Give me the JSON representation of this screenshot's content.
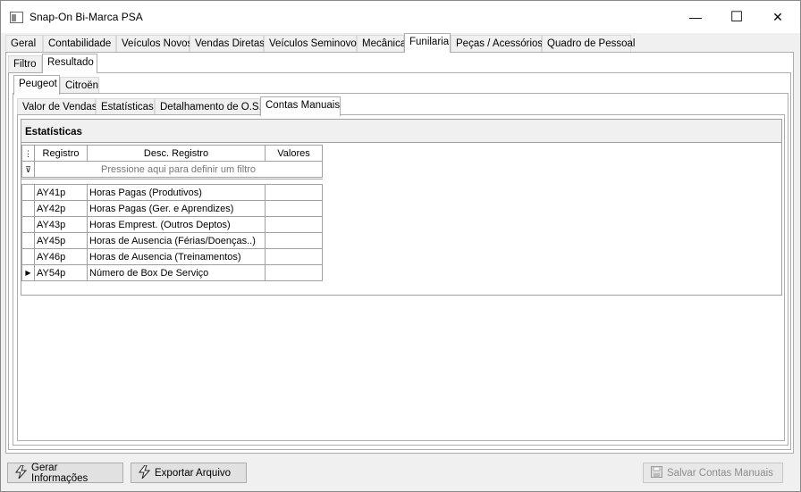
{
  "window": {
    "title": "Snap-On Bi-Marca PSA",
    "min_glyph": "—",
    "max_glyph": "☐",
    "close_glyph": "✕"
  },
  "main_tabs": [
    "Geral",
    "Contabilidade",
    "Veículos Novos",
    "Vendas Diretas",
    "Veículos Seminovos",
    "Mecânica",
    "Funilaria",
    "Peças / Acessórios",
    "Quadro de Pessoal"
  ],
  "main_tab_active": "Funilaria",
  "sub_tabs": [
    "Filtro",
    "Resultado"
  ],
  "sub_tab_active": "Resultado",
  "brand_tabs": [
    "Peugeot",
    "Citroën"
  ],
  "brand_tab_active": "Peugeot",
  "report_tabs": [
    "Valor de Vendas",
    "Estatísticas",
    "Detalhamento de O.S.",
    "Contas Manuais"
  ],
  "report_tab_active": "Contas Manuais",
  "section_title": "Estatísticas",
  "grid": {
    "headers": {
      "registro": "Registro",
      "desc": "Desc. Registro",
      "valores": "Valores"
    },
    "filter_hint": "Pressione aqui para definir um filtro",
    "rows": [
      {
        "registro": "AY41p",
        "desc": "Horas Pagas (Produtivos)",
        "valor": ""
      },
      {
        "registro": "AY42p",
        "desc": "Horas Pagas (Ger. e Aprendizes)",
        "valor": ""
      },
      {
        "registro": "AY43p",
        "desc": "Horas Emprest. (Outros Deptos)",
        "valor": ""
      },
      {
        "registro": "AY45p",
        "desc": "Horas de Ausencia (Férias/Doenças..)",
        "valor": ""
      },
      {
        "registro": "AY46p",
        "desc": "Horas de Ausencia (Treinamentos)",
        "valor": ""
      },
      {
        "registro": "AY54p",
        "desc": "Número de Box De Serviço",
        "valor": ""
      }
    ],
    "current_row": 5
  },
  "buttons": {
    "gerar": "Gerar Informações",
    "exportar": "Exportar Arquivo",
    "salvar": "Salvar Contas Manuais"
  }
}
